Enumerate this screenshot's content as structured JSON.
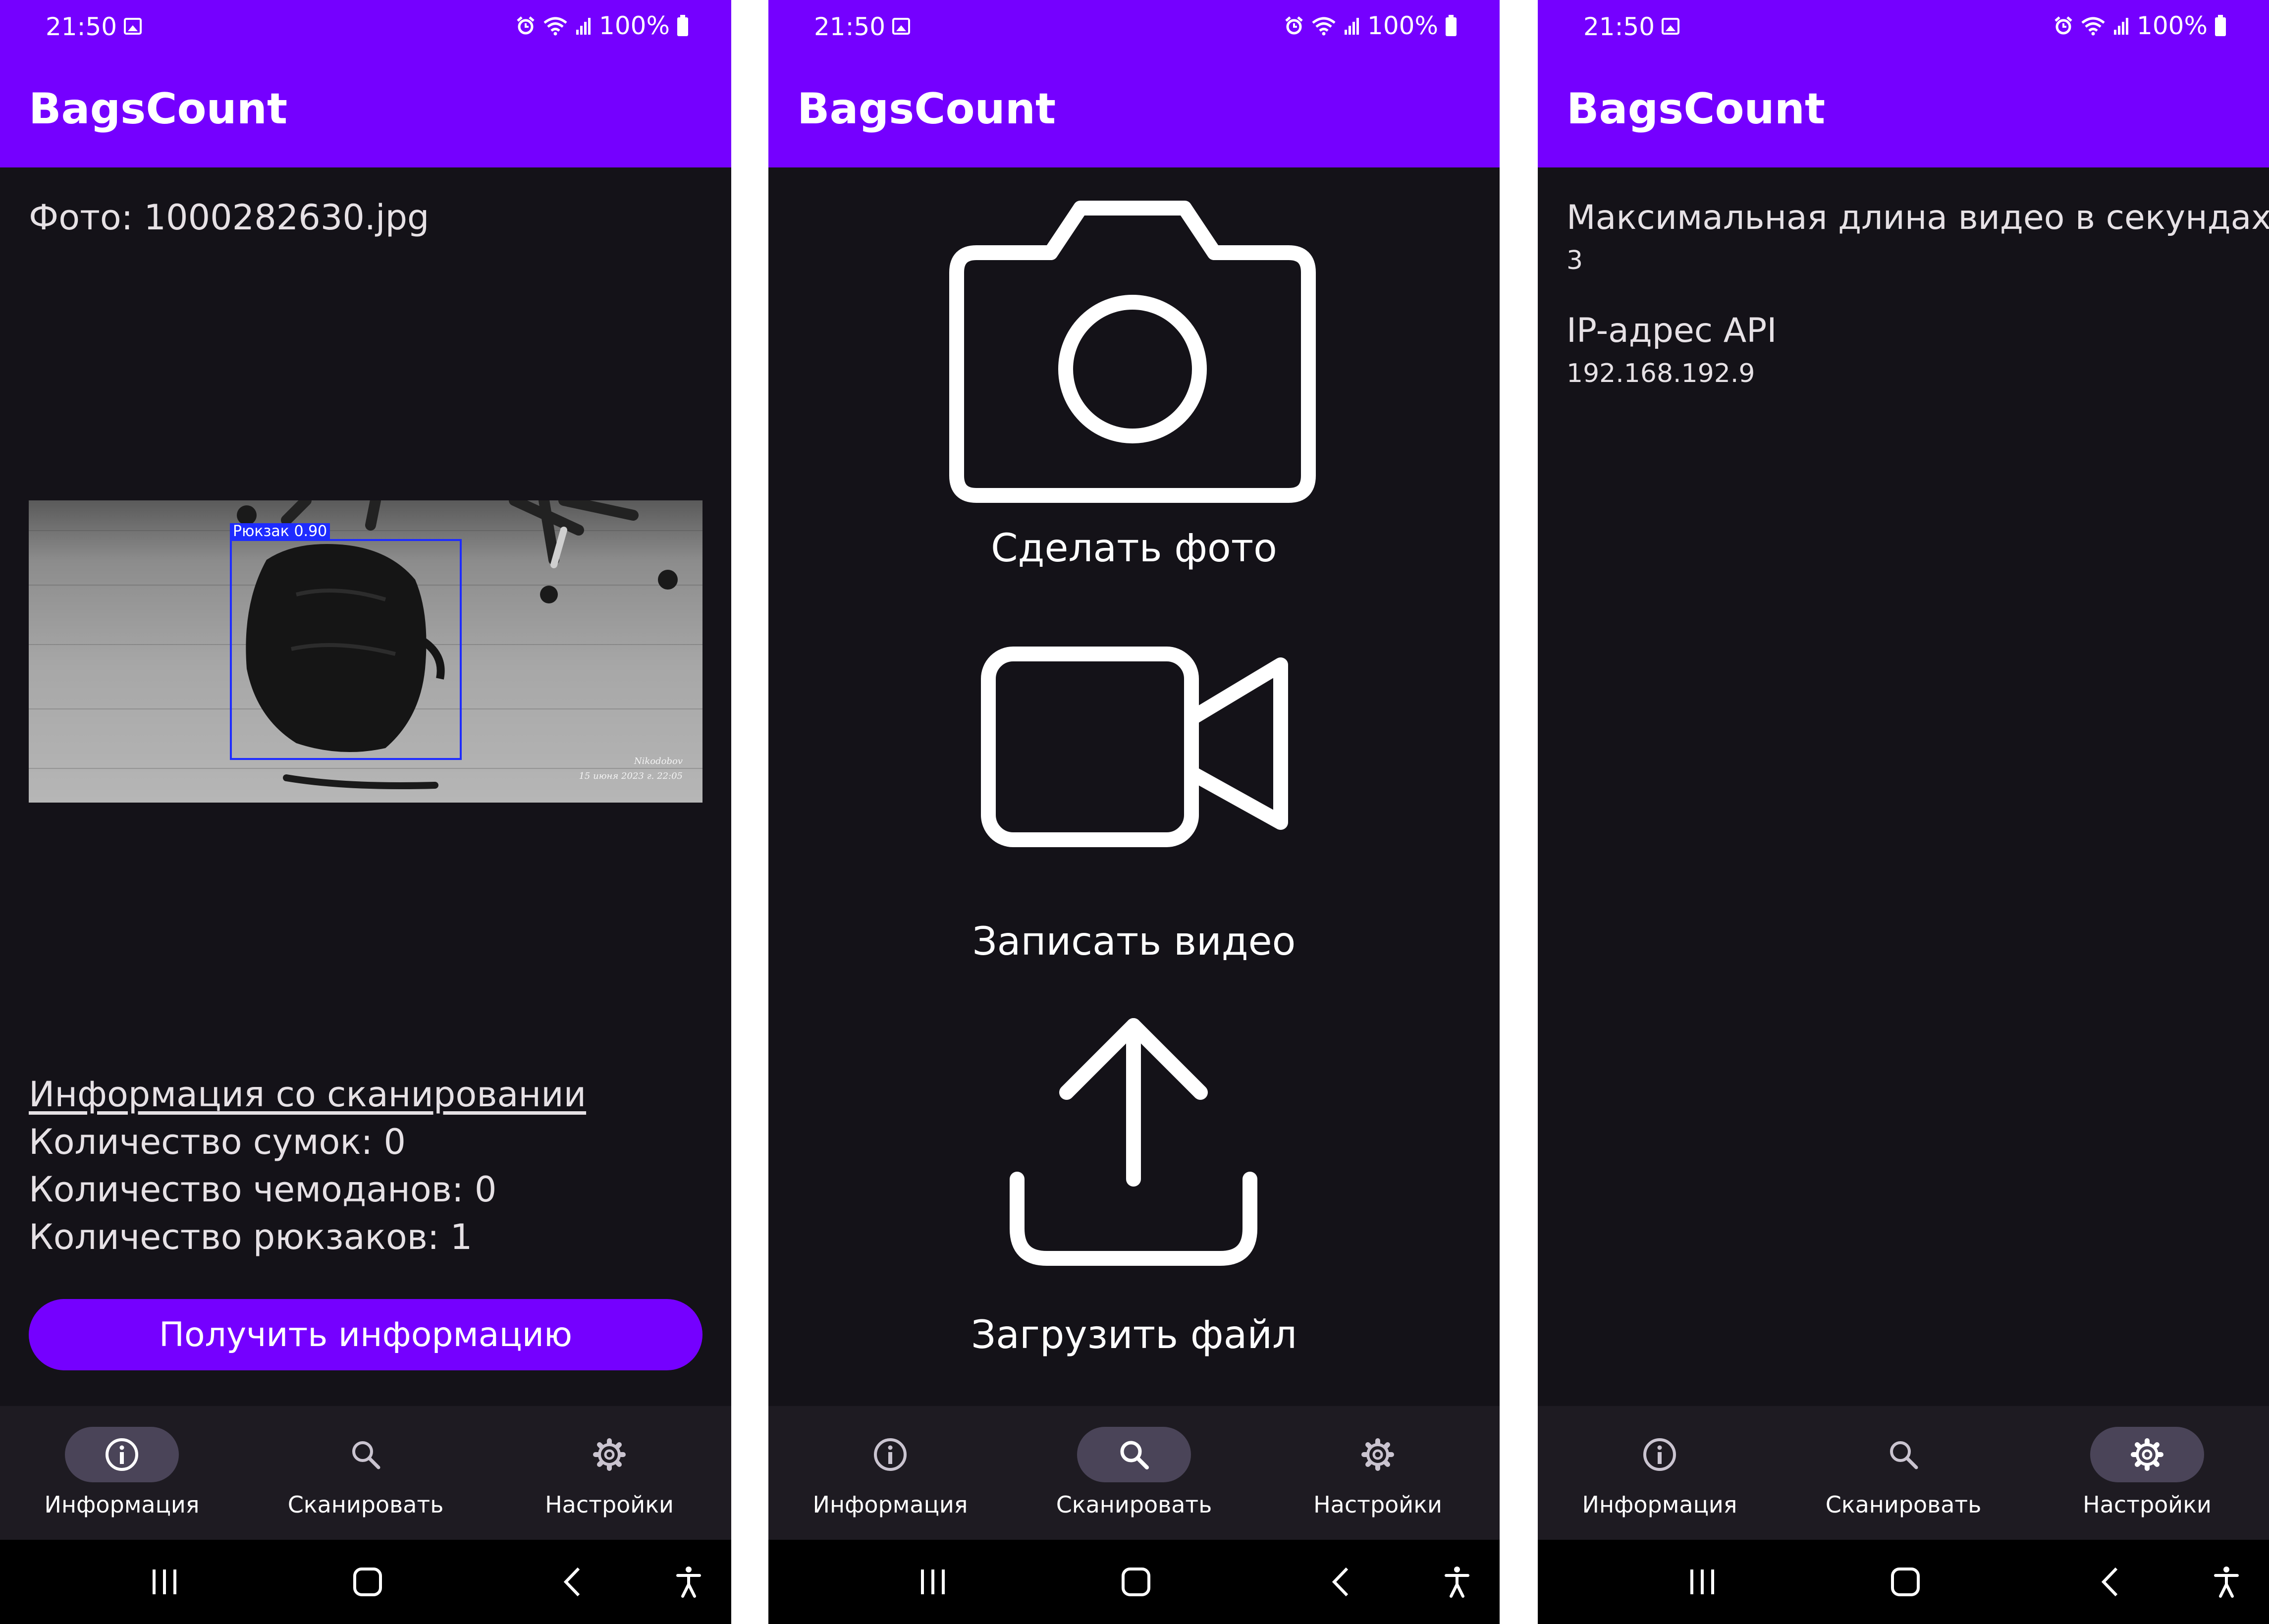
{
  "status_bar": {
    "time": "21:50",
    "battery": "100%"
  },
  "app": {
    "title": "BagsCount"
  },
  "nav": {
    "info_label": "Информация",
    "scan_label": "Сканировать",
    "settings_label": "Настройки"
  },
  "info_screen": {
    "photo_label": "Фото: 1000282630.jpg",
    "detection_label": "Рюкзак 0.90",
    "watermark_line1": "Nikodobov",
    "watermark_line2": "15 июня 2023 г. 22:05",
    "scan_heading": "Информация со сканировании",
    "bags_count": "Количество сумок: 0",
    "suitcases_count": "Количество чемоданов: 0",
    "backpacks_count": "Количество рюкзаков: 1",
    "get_info_button": "Получить информацию"
  },
  "scan_screen": {
    "take_photo_label": "Сделать фото",
    "record_video_label": "Записать видео",
    "upload_file_label": "Загрузить файл"
  },
  "settings_screen": {
    "max_video_title": "Максимальная длина видео в секундах",
    "max_video_value": "3",
    "api_ip_title": "IP-адрес API",
    "api_ip_value": "192.168.192.9"
  },
  "colors": {
    "accent": "#7500ff",
    "background": "#141218",
    "nav_background": "#1e1b22",
    "nav_active_pill": "#4a4458",
    "detection_box": "#1e2cff"
  },
  "active_tabs": [
    "info",
    "scan",
    "settings"
  ]
}
